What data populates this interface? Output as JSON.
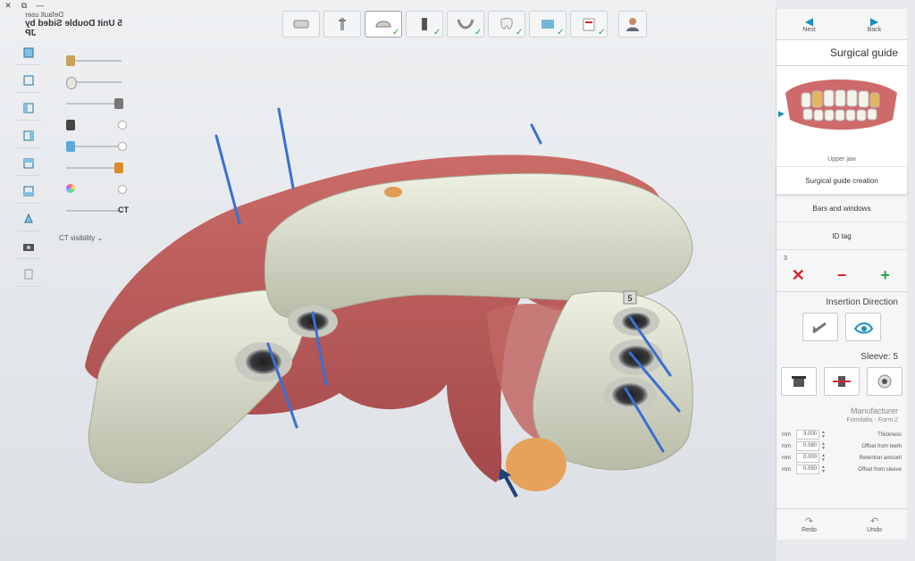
{
  "window": {
    "close_label": "✕",
    "restore_label": "⧉",
    "minimize_label": "—"
  },
  "project": {
    "user": "Default user",
    "name": "5 Unit Double Sided by JP"
  },
  "toolbar": {
    "steps": [
      {
        "name": "scan",
        "checked": false
      },
      {
        "name": "implant",
        "checked": false
      },
      {
        "name": "guide",
        "checked": true
      },
      {
        "name": "sleeve",
        "checked": true
      },
      {
        "name": "jaw",
        "checked": true
      },
      {
        "name": "tooth",
        "checked": true
      },
      {
        "name": "dicom",
        "checked": true
      },
      {
        "name": "report",
        "checked": true
      }
    ]
  },
  "left_sliders": {
    "ct_label": "CT",
    "ct_visibility": "CT visibility"
  },
  "panel": {
    "next_label": "Next",
    "back_label": "Back",
    "title": "Surgical guide",
    "jaw_label": "Upper jaw",
    "menu": [
      "Surgical guide creation",
      "Bars and windows",
      "ID tag"
    ],
    "count": "3",
    "insertion_direction": "Insertion Direction",
    "sleeve_label": "Sleeve: 5",
    "manufacturer_label": "Manufacturer",
    "manufacturer_value": "Formlabs - Form 2",
    "params": [
      {
        "label": "Thickness",
        "value": "3.000",
        "unit": "mm"
      },
      {
        "label": "Offset from teeth",
        "value": "0.080",
        "unit": "mm"
      },
      {
        "label": "Retention amount",
        "value": "0.000",
        "unit": "mm"
      },
      {
        "label": "Offset from sleeve",
        "value": "0.050",
        "unit": "mm"
      }
    ],
    "undo_label": "Undo",
    "redo_label": "Redo"
  },
  "viewport": {
    "sleeve_tag": "5"
  },
  "colors": {
    "accent": "#1b8fc4",
    "guide": "#d9dccb",
    "gum": "#b84a4a",
    "pin": "#3b6fd1",
    "remove": "#d9252a",
    "add": "#2ea44f"
  }
}
